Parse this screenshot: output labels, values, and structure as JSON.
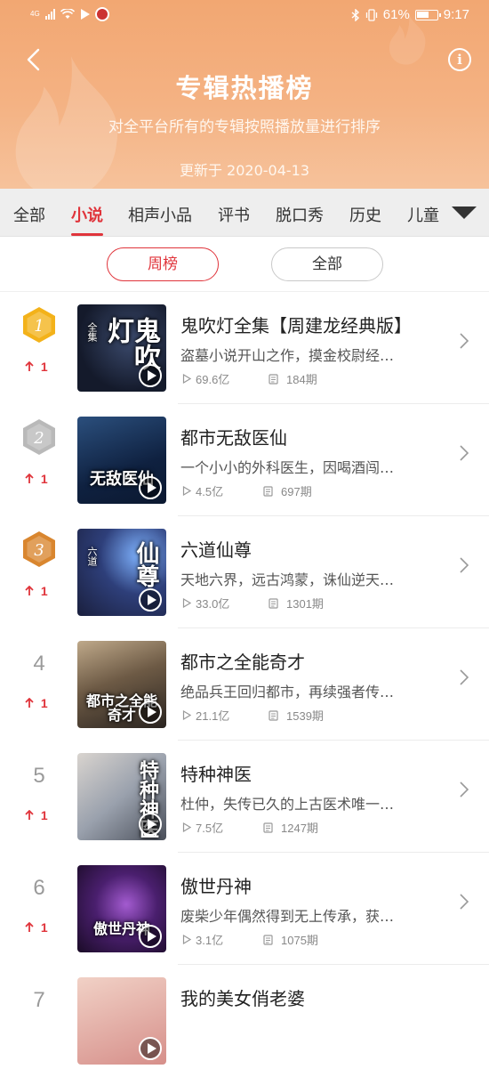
{
  "status_bar": {
    "network_label": "4G",
    "battery_percent": "61%",
    "time": "9:17"
  },
  "header": {
    "title": "专辑热播榜",
    "subtitle": "对全平台所有的专辑按照播放量进行排序",
    "updated": "更新于 2020-04-13",
    "info_symbol": "i"
  },
  "categories": [
    {
      "label": "全部",
      "active": false
    },
    {
      "label": "小说",
      "active": true
    },
    {
      "label": "相声小品",
      "active": false
    },
    {
      "label": "评书",
      "active": false
    },
    {
      "label": "脱口秀",
      "active": false
    },
    {
      "label": "历史",
      "active": false
    },
    {
      "label": "儿童",
      "active": false
    }
  ],
  "periods": [
    {
      "label": "周榜",
      "active": true
    },
    {
      "label": "全部",
      "active": false
    }
  ],
  "ranking": [
    {
      "rank": "1",
      "medal": "gold",
      "trend": "1",
      "title": "鬼吹灯全集【周建龙经典版】",
      "desc": "盗墓小说开山之作，摸金校尉经…",
      "plays": "69.6亿",
      "episodes": "184期",
      "cover_text": "鬼吹灯",
      "cover_small": "全集"
    },
    {
      "rank": "2",
      "medal": "silver",
      "trend": "1",
      "title": "都市无敌医仙",
      "desc": "一个小小的外科医生，因喝酒闯…",
      "plays": "4.5亿",
      "episodes": "697期",
      "cover_text": "无敌医仙",
      "cover_small": ""
    },
    {
      "rank": "3",
      "medal": "bronze",
      "trend": "1",
      "title": "六道仙尊",
      "desc": "天地六界，远古鸿蒙，诛仙逆天…",
      "plays": "33.0亿",
      "episodes": "1301期",
      "cover_text": "仙尊",
      "cover_small": "六道"
    },
    {
      "rank": "4",
      "medal": "",
      "trend": "1",
      "title": "都市之全能奇才",
      "desc": "绝品兵王回归都市，再续强者传…",
      "plays": "21.1亿",
      "episodes": "1539期",
      "cover_text": "都市之全能奇才",
      "cover_small": ""
    },
    {
      "rank": "5",
      "medal": "",
      "trend": "1",
      "title": "特种神医",
      "desc": "杜仲，失传已久的上古医术唯一…",
      "plays": "7.5亿",
      "episodes": "1247期",
      "cover_text": "特种神医",
      "cover_small": ""
    },
    {
      "rank": "6",
      "medal": "",
      "trend": "1",
      "title": "傲世丹神",
      "desc": "废柴少年偶然得到无上传承，获…",
      "plays": "3.1亿",
      "episodes": "1075期",
      "cover_text": "傲世丹神",
      "cover_small": ""
    },
    {
      "rank": "7",
      "medal": "",
      "trend": "",
      "title": "我的美女俏老婆",
      "desc": "",
      "plays": "",
      "episodes": "",
      "cover_text": "",
      "cover_small": ""
    }
  ],
  "colors": {
    "accent": "#e0343b",
    "header_top": "#f2a772",
    "header_bottom": "#f6c29b",
    "gold_medal": "#f3b21a",
    "silver_medal": "#b9b9b9",
    "bronze_medal": "#d9862f"
  },
  "icons": {
    "back": "chevron-left-icon",
    "info": "info-icon",
    "more": "triangle-down-icon",
    "play": "play-icon",
    "plays": "play-count-icon",
    "episodes": "episode-list-icon",
    "trend": "arrow-up-icon",
    "row_arrow": "chevron-right-icon"
  }
}
